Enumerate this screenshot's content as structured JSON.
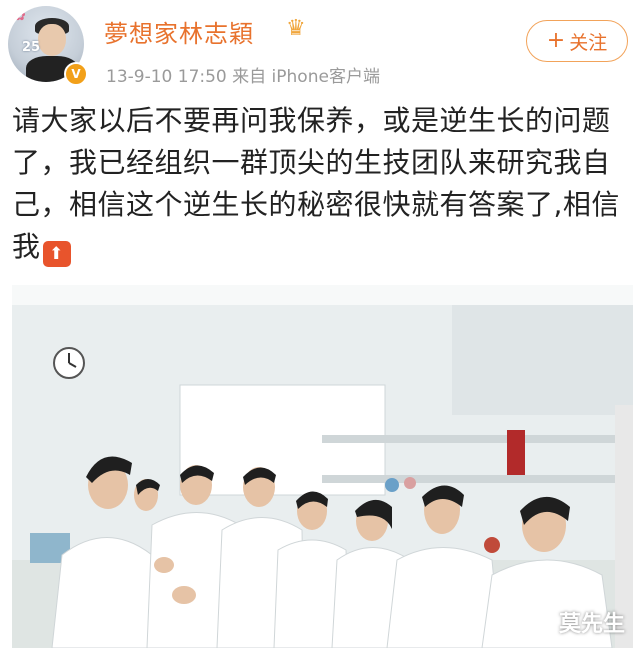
{
  "header": {
    "username": "夢想家林志穎",
    "timestamp": "13-9-10 17:50",
    "source": "来自 iPhone客户端",
    "follow_label": "关注",
    "avatar_badge": "25",
    "verified_mark": "V"
  },
  "post": {
    "text": "请大家以后不要再问我保养，或是逆生长的问题了，我已经组织一群顶尖的生技团队来研究我自己，相信这个逆生长的秘密很快就有答案了,相信我",
    "source_icon": "rocket-icon"
  },
  "photo": {
    "watermark": "莫先生"
  },
  "colors": {
    "brand_orange": "#e8722d",
    "verified": "#f2a019",
    "text": "#222222",
    "meta": "#9a9a9a"
  }
}
